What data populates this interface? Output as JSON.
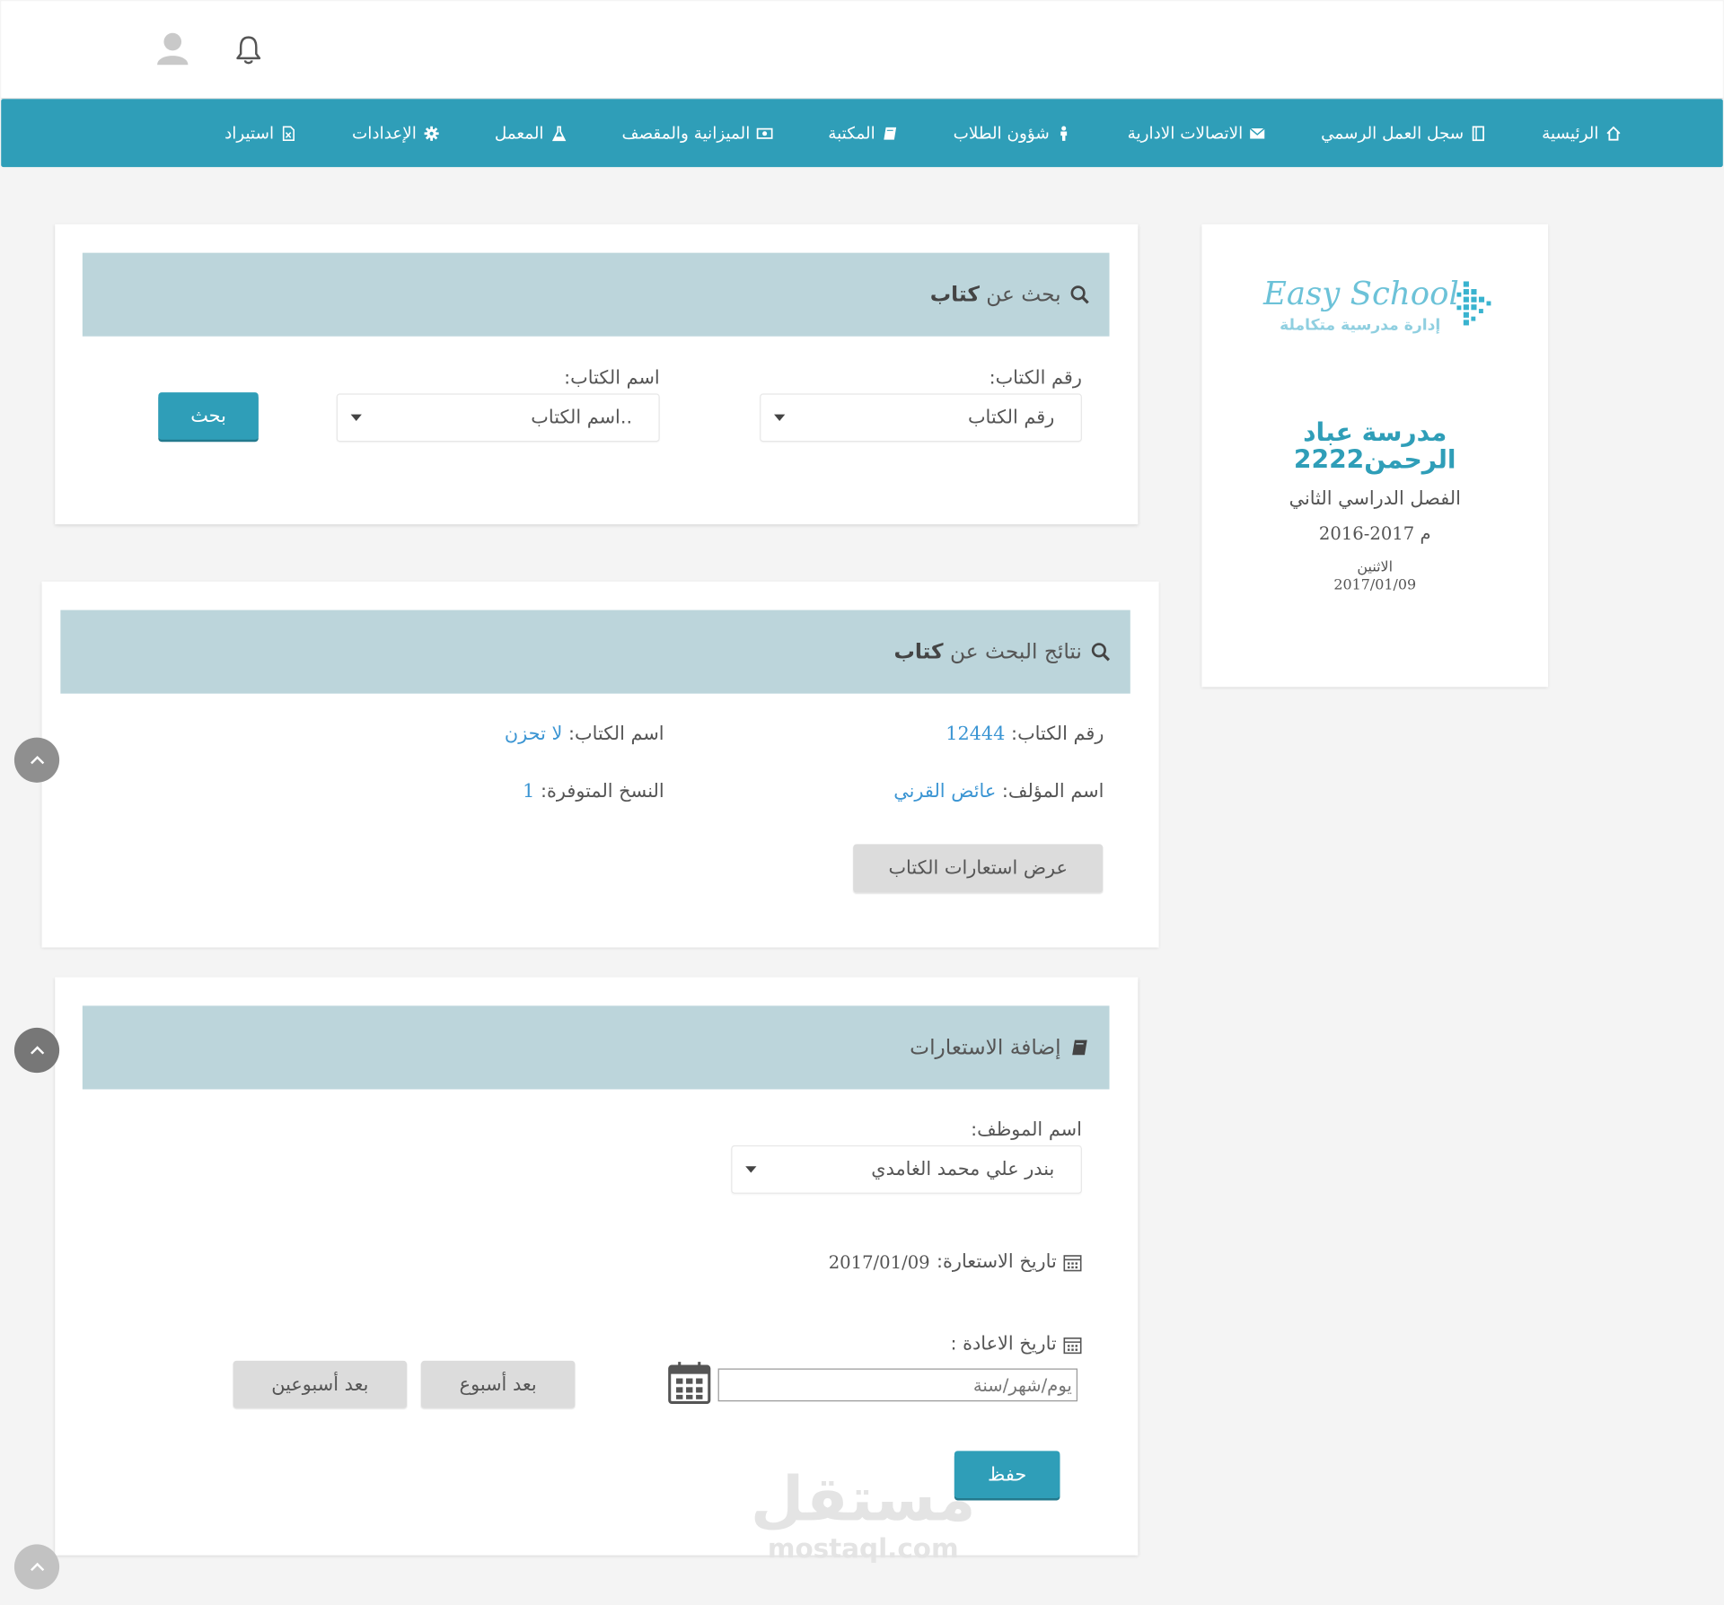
{
  "nav": {
    "items": [
      {
        "label": "الرئيسية",
        "icon": "home-icon"
      },
      {
        "label": "سجل العمل الرسمي",
        "icon": "notebook-icon"
      },
      {
        "label": "الاتصالات الادارية",
        "icon": "envelope-icon"
      },
      {
        "label": "شؤون الطلاب",
        "icon": "student-icon"
      },
      {
        "label": "المكتبة",
        "icon": "book-icon"
      },
      {
        "label": "الميزانية والمقصف",
        "icon": "money-icon"
      },
      {
        "label": "المعمل",
        "icon": "flask-icon"
      },
      {
        "label": "الإعدادات",
        "icon": "gear-icon"
      },
      {
        "label": "استيراد",
        "icon": "excel-file-icon"
      }
    ]
  },
  "school": {
    "logo_title": "Easy School",
    "logo_subtitle": "إدارة مدرسية متكاملة",
    "name_line1": "مدرسة عباد",
    "name_line2": "الرحمن2222",
    "semester": "الفصل الدراسي الثاني",
    "year": "2016-2017 م",
    "day": "الاثنين",
    "date": "2017/01/09"
  },
  "search": {
    "title_prefix": "بحث عن",
    "title_bold": "كتاب",
    "book_number_label": "رقم الكتاب:",
    "book_number_value": "رقم الكتاب",
    "book_name_label": "اسم الكتاب:",
    "book_name_value": "اسم الكتاب..",
    "search_button": "بحث"
  },
  "results": {
    "title_prefix": "نتائج البحث عن",
    "title_bold": "كتاب",
    "book_number_label": "رقم الكتاب:",
    "book_number_value": "12444",
    "book_name_label": "اسم الكتاب:",
    "book_name_value": "لا تحزن",
    "author_label": "اسم المؤلف:",
    "author_value": "عائض القرني",
    "copies_label": "النسخ المتوفرة:",
    "copies_value": "1",
    "view_loans_button": "عرض استعارات الكتاب"
  },
  "loan": {
    "title": "إضافة الاستعارات",
    "employee_label": "اسم الموظف:",
    "employee_value": "بندر علي محمد الغامدي",
    "loan_date_label": "تاريخ الاستعارة:",
    "loan_date_value": "2017/01/09",
    "return_date_label": "تاريخ الاعادة :",
    "return_date_placeholder": "يوم/شهر/سنة",
    "after_week_button": "بعد أسبوع",
    "after_two_weeks_button": "بعد أسبوعين",
    "save_button": "حفظ"
  },
  "watermark": {
    "arabic": "مستقل",
    "latin": "mostaql.com"
  }
}
